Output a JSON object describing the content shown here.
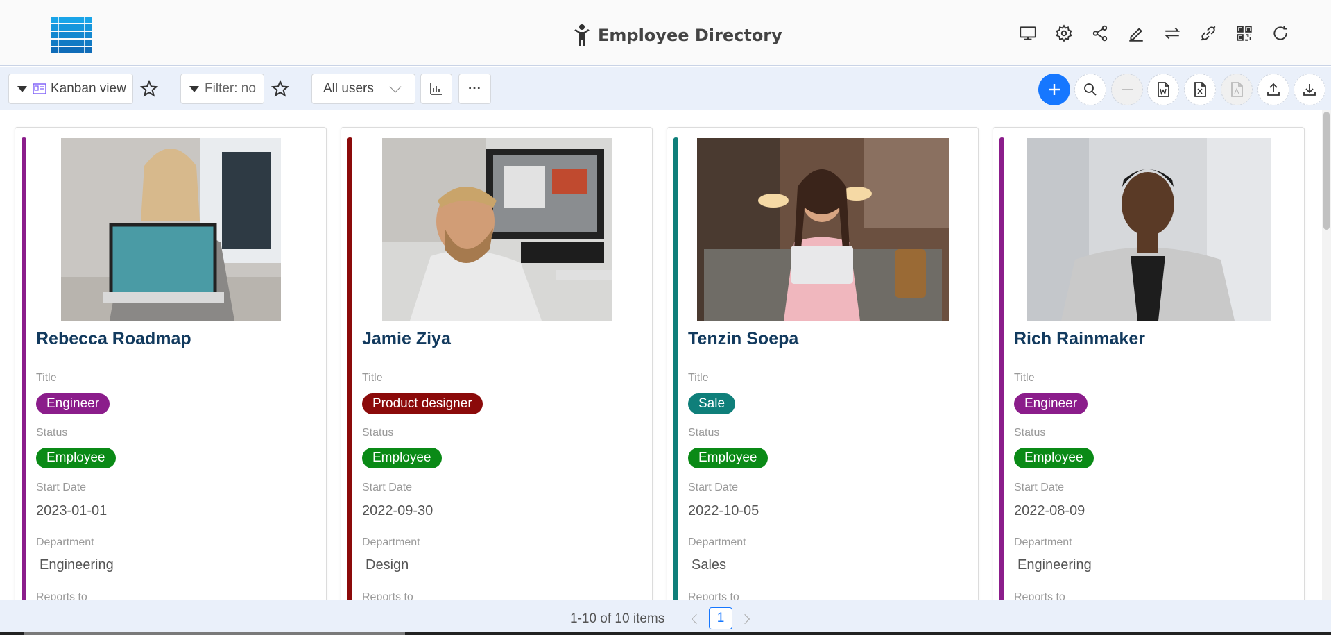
{
  "header": {
    "title": "Employee Directory",
    "icons": [
      "desktop-icon",
      "settings-icon",
      "share-icon",
      "edit-icon",
      "swap-icon",
      "link-icon",
      "qrcode-icon",
      "reload-icon"
    ]
  },
  "toolbar": {
    "view_label": "Kanban view",
    "filter_label": "Filter: no",
    "users_select": "All users",
    "more_label": "···"
  },
  "colors": {
    "purple": "#8b1d8b",
    "darkred": "#8b0a0a",
    "teal": "#0f7f7a",
    "green": "#0a8a16",
    "primary": "#1677ff",
    "name_color": "#123a5e"
  },
  "labels": {
    "title": "Title",
    "status": "Status",
    "start_date": "Start Date",
    "department": "Department",
    "reports_to": "Reports to"
  },
  "cards": [
    {
      "name": "Rebecca Roadmap",
      "title": "Engineer",
      "status": "Employee",
      "start_date": "2023-01-01",
      "department": "Engineering",
      "accent": "#8b1d8b"
    },
    {
      "name": "Jamie Ziya",
      "title": "Product designer",
      "status": "Employee",
      "start_date": "2022-09-30",
      "department": "Design",
      "accent": "#8b0a0a"
    },
    {
      "name": "Tenzin Soepa",
      "title": "Sale",
      "status": "Employee",
      "start_date": "2022-10-05",
      "department": "Sales",
      "accent": "#0f7f7a"
    },
    {
      "name": "Rich Rainmaker",
      "title": "Engineer",
      "status": "Employee",
      "start_date": "2022-08-09",
      "department": "Engineering",
      "accent": "#8b1d8b"
    }
  ],
  "pagination": {
    "summary": "1-10 of 10 items",
    "current_page": "1"
  }
}
